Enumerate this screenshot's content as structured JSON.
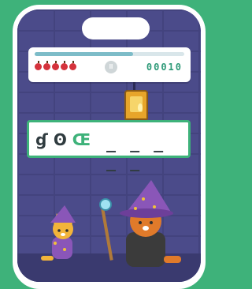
{
  "progress": 0.66,
  "lives": {
    "count": 5,
    "icon": "apple-icon",
    "color": "#d5333c"
  },
  "pause_icon": "pause-icon",
  "pause_glyph": "II",
  "score": "00010",
  "word": {
    "letters": [
      "ɠ",
      "ʘ"
    ],
    "highlight": "Œ",
    "blanks": "_ _ _ _ _"
  },
  "colors": {
    "accent": "#3eb27a",
    "wall": "#4b4b8a"
  }
}
